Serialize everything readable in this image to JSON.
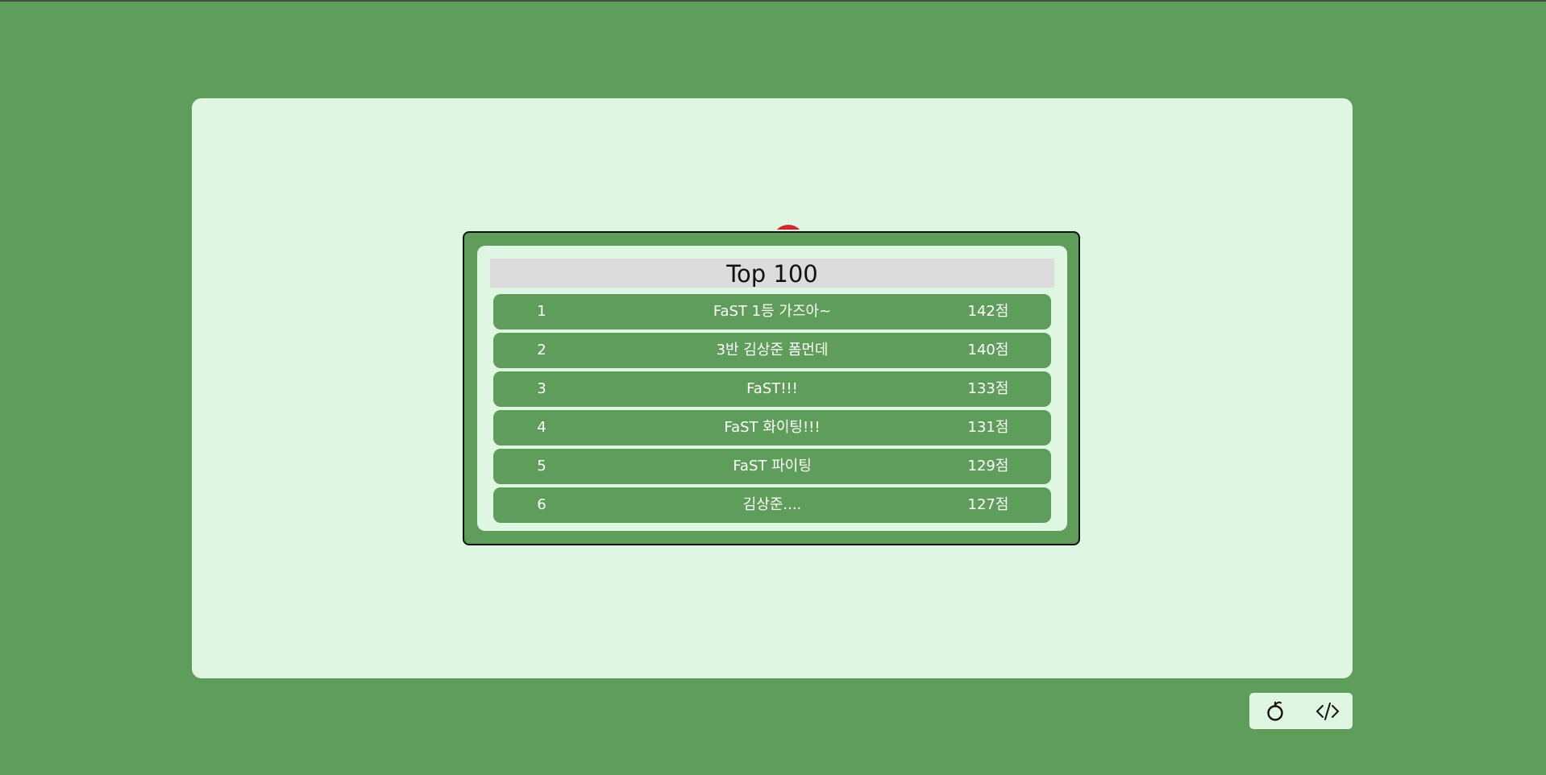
{
  "leaderboard": {
    "title": "Top 100",
    "entries": [
      {
        "rank": "1",
        "name": "FaST 1등 가즈아~",
        "score": "142점"
      },
      {
        "rank": "2",
        "name": "3반 김상준 폼먼데",
        "score": "140점"
      },
      {
        "rank": "3",
        "name": "FaST!!!",
        "score": "133점"
      },
      {
        "rank": "4",
        "name": "FaST 화이팅!!!",
        "score": "131점"
      },
      {
        "rank": "5",
        "name": "FaST 파이팅",
        "score": "129점"
      },
      {
        "rank": "6",
        "name": "김상준....",
        "score": "127점"
      }
    ]
  },
  "controls": {
    "apple_icon": "apple-outline-icon",
    "code_icon": "code-brackets-icon"
  },
  "colors": {
    "background": "#5f9e5a",
    "board": "#dff6e2",
    "row": "#5f9e5a",
    "header": "#dcdcdc",
    "apple": "#d62630"
  }
}
